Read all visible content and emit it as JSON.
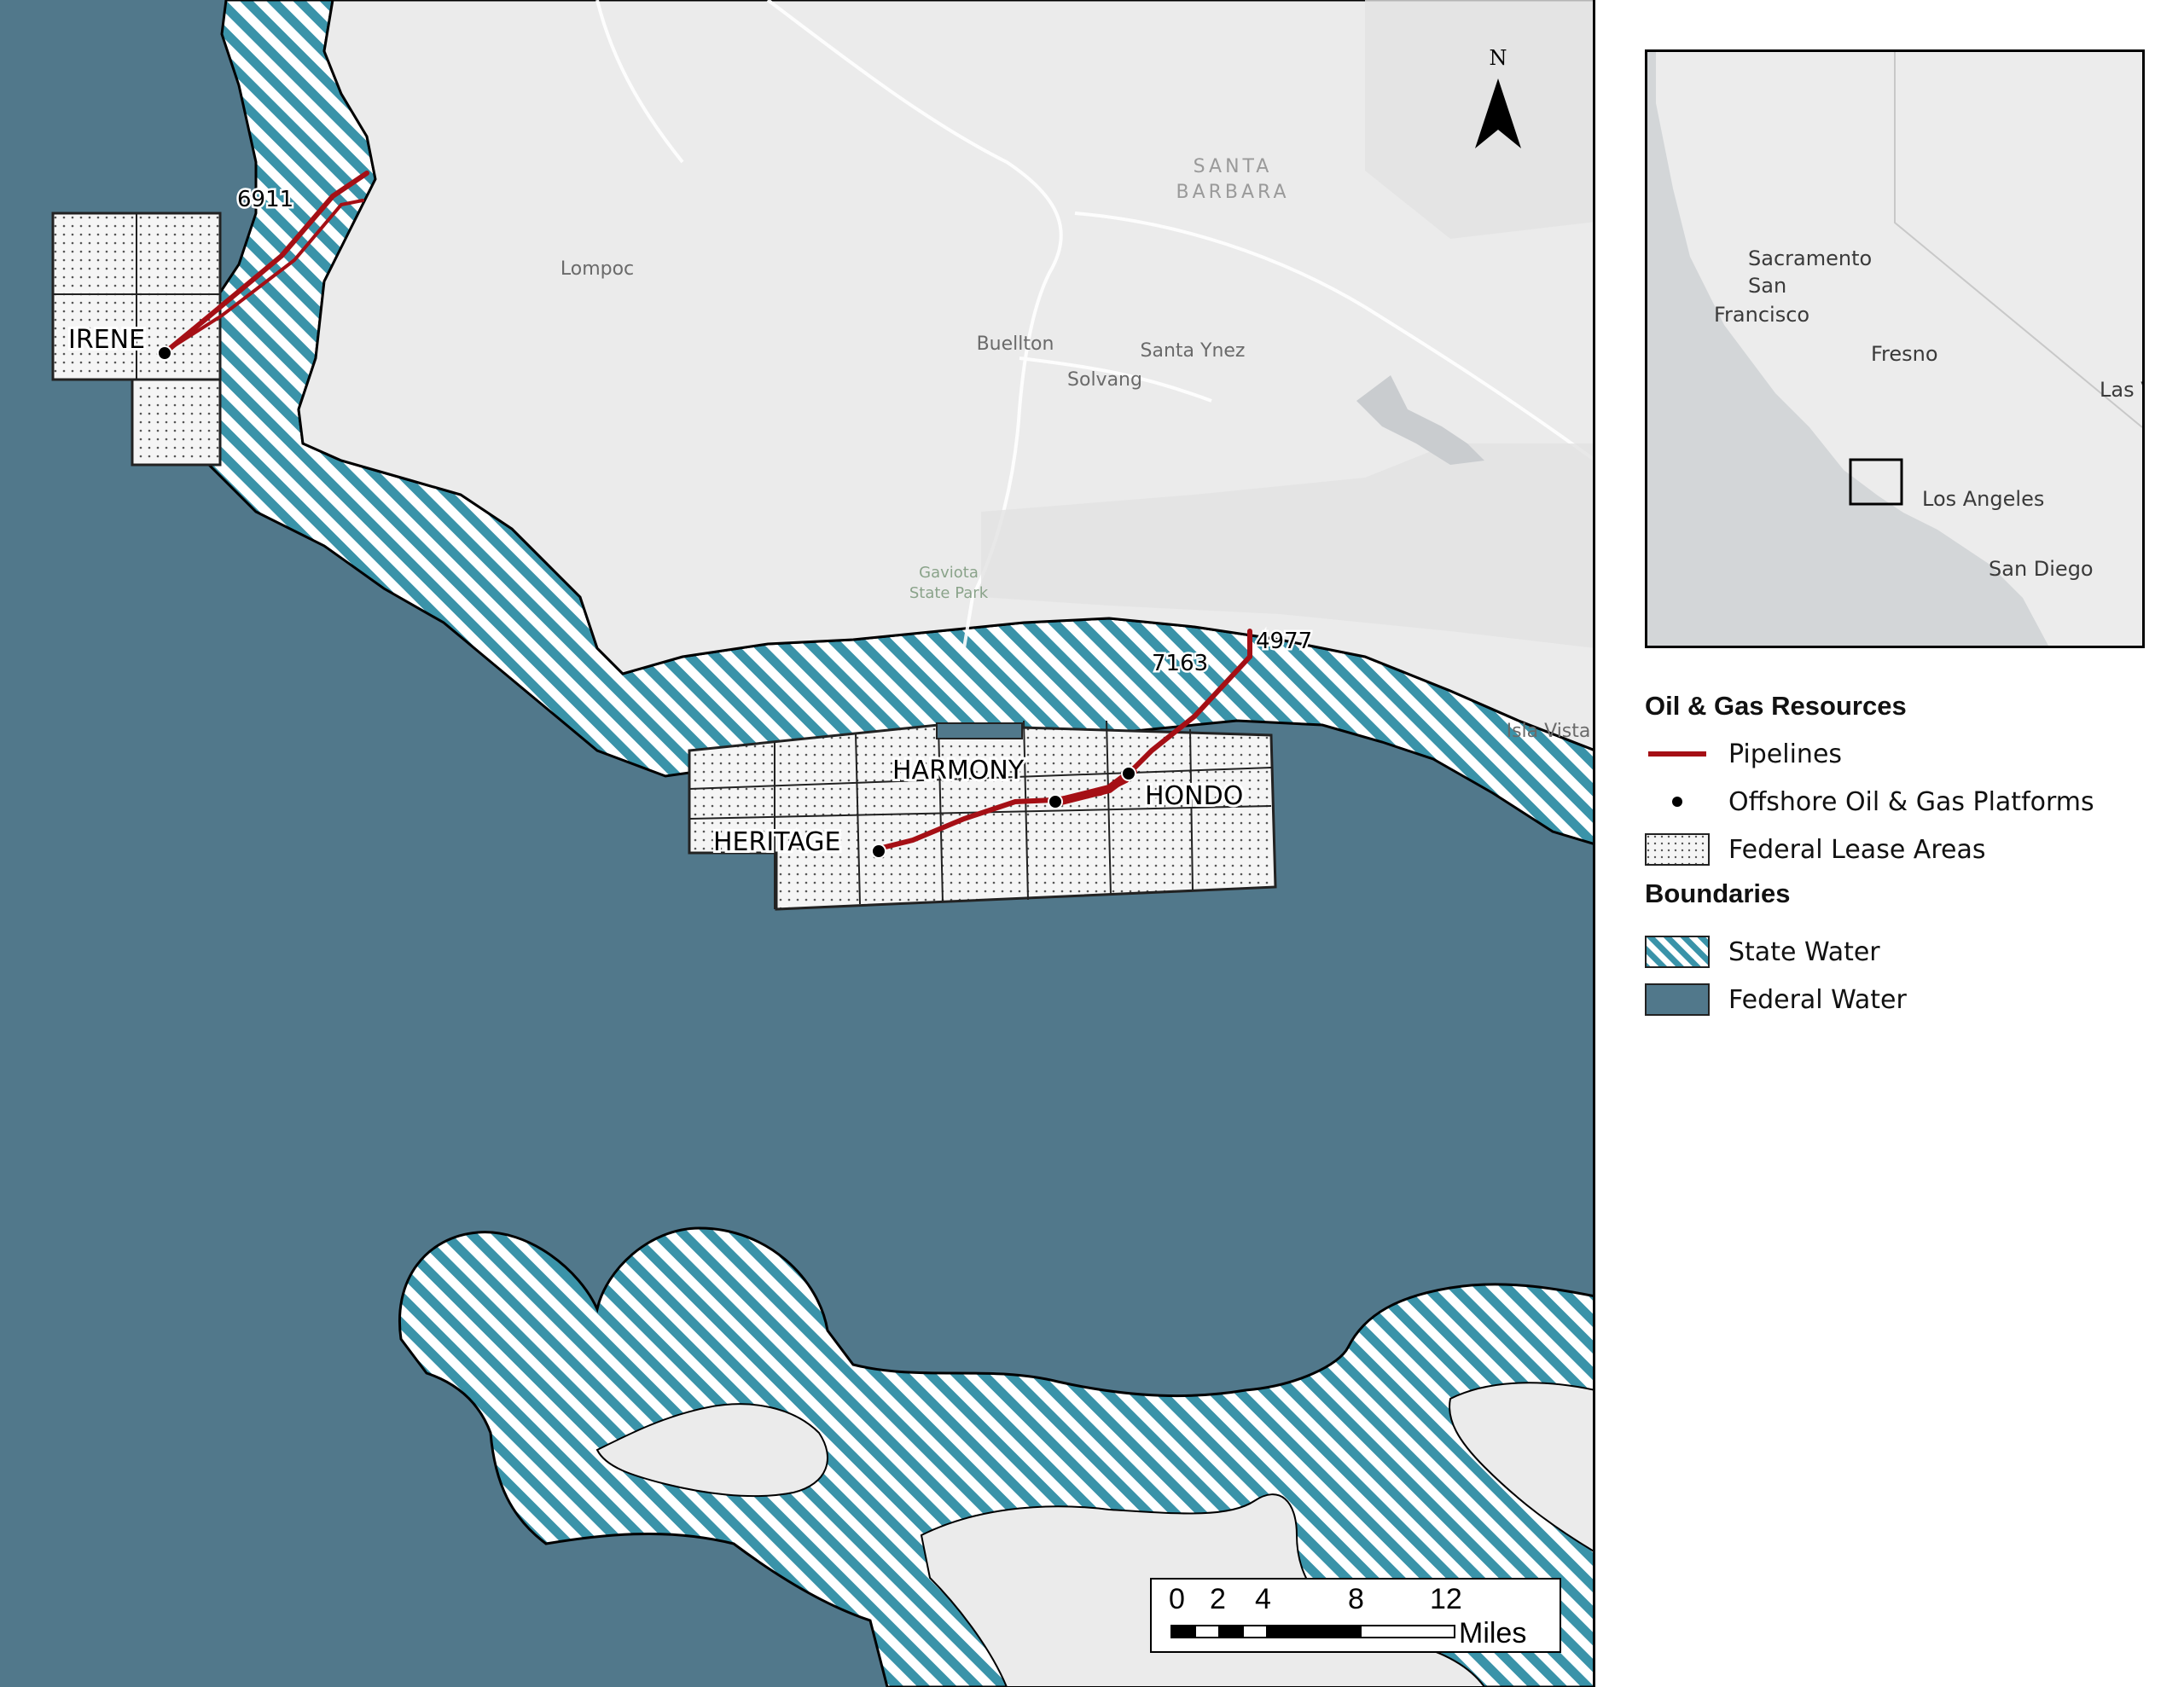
{
  "map": {
    "county_label": [
      "SANTA",
      "BARBARA"
    ],
    "places": [
      "Lompoc",
      "Buellton",
      "Santa Ynez",
      "Solvang",
      "Isla Vista"
    ],
    "park": [
      "Gaviota",
      "State Park"
    ],
    "platforms": [
      "IRENE",
      "HARMONY",
      "HONDO",
      "HERITAGE"
    ],
    "pipelines": [
      "6911",
      "7163",
      "4977"
    ],
    "north_label": "N",
    "colors": {
      "federal_water": "#51788b",
      "state_water_stripe": "#3a93a9",
      "land": "#ebebeb",
      "pipeline": "#a50f15",
      "lease_fill": "#f5f5f5"
    }
  },
  "inset": {
    "cities": [
      "Sacramento",
      "San",
      "Francisco",
      "Fresno",
      "Las V",
      "Los Angeles",
      "San Diego"
    ]
  },
  "legend": {
    "section1_title": "Oil & Gas Resources",
    "items1": [
      "Pipelines",
      "Offshore Oil & Gas Platforms",
      "Federal Lease Areas"
    ],
    "section2_title": "Boundaries",
    "items2": [
      "State Water",
      "Federal Water"
    ]
  },
  "scale": {
    "ticks": [
      "0",
      "2",
      "4",
      "8",
      "12"
    ],
    "unit": "Miles"
  }
}
